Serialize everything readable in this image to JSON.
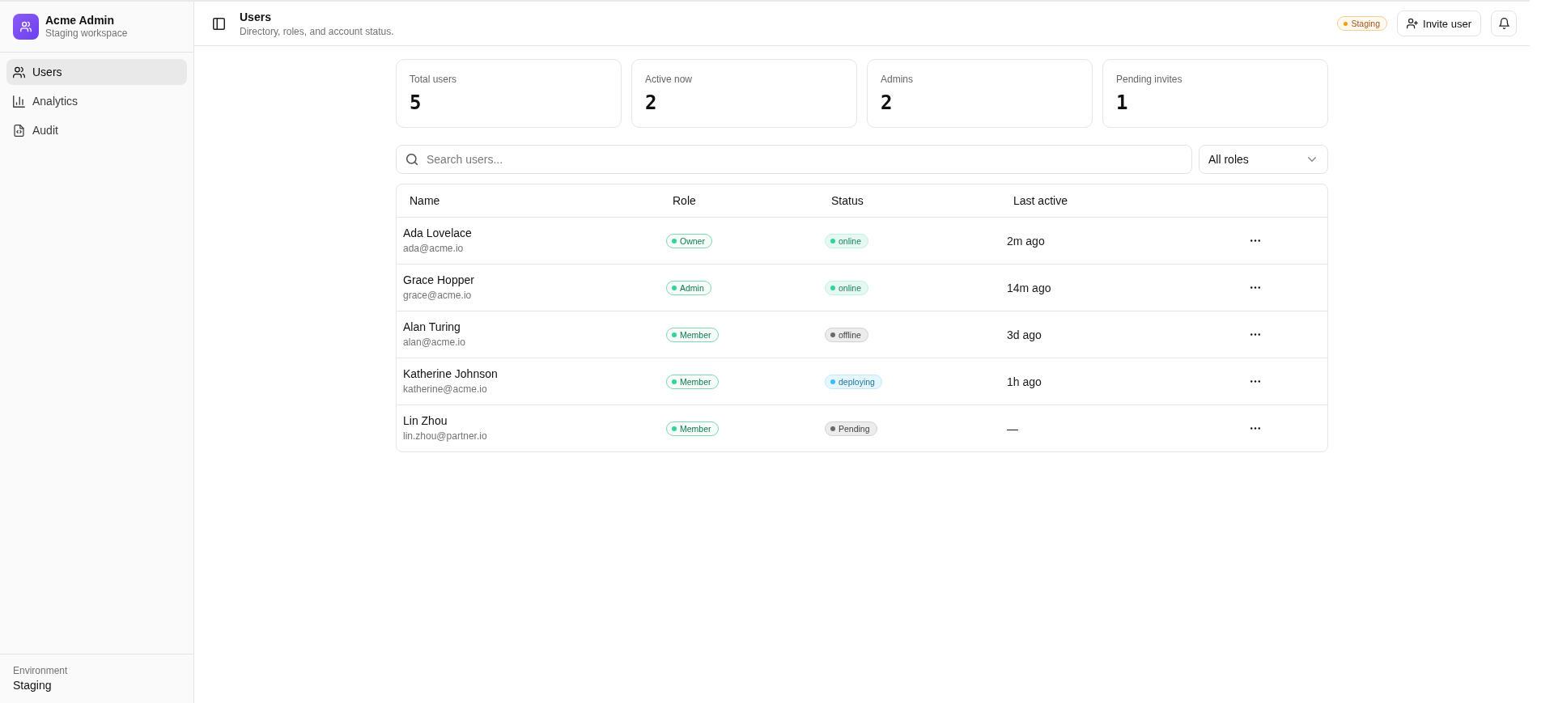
{
  "sidebar": {
    "app_name": "Acme Admin",
    "workspace": "Staging workspace",
    "items": [
      {
        "label": "Users",
        "kind": "users",
        "selected": true
      },
      {
        "label": "Analytics",
        "kind": "analytics",
        "selected": false
      },
      {
        "label": "Audit",
        "kind": "audit",
        "selected": false
      }
    ],
    "footer": {
      "label": "Environment",
      "value": "Staging"
    }
  },
  "header": {
    "title": "Users",
    "subtitle": "Directory, roles, and account status.",
    "environment_badge": "Staging",
    "invite_button": "Invite user"
  },
  "stats": [
    {
      "label": "Total users",
      "value": "5"
    },
    {
      "label": "Active now",
      "value": "2"
    },
    {
      "label": "Admins",
      "value": "2"
    },
    {
      "label": "Pending invites",
      "value": "1"
    }
  ],
  "search": {
    "placeholder": "Search users..."
  },
  "role_filter": {
    "value": "All roles"
  },
  "table": {
    "columns": [
      "Name",
      "Role",
      "Status",
      "Last active"
    ],
    "rows": [
      {
        "name": "Ada Lovelace",
        "email": "ada@acme.io",
        "role": "Owner",
        "status": {
          "label": "online",
          "color": "#34d399"
        },
        "last_active": "2m ago"
      },
      {
        "name": "Grace Hopper",
        "email": "grace@acme.io",
        "role": "Admin",
        "status": {
          "label": "online",
          "color": "#34d399"
        },
        "last_active": "14m ago"
      },
      {
        "name": "Alan Turing",
        "email": "alan@acme.io",
        "role": "Member",
        "status": {
          "label": "offline",
          "color": "#6b6b6b"
        },
        "last_active": "3d ago"
      },
      {
        "name": "Katherine Johnson",
        "email": "katherine@acme.io",
        "role": "Member",
        "status": {
          "label": "deploying",
          "color": "#38bdf8"
        },
        "last_active": "1h ago"
      },
      {
        "name": "Lin Zhou",
        "email": "lin.zhou@partner.io",
        "role": "Member",
        "status": {
          "label": "Pending",
          "color": "#6b6b6b"
        },
        "last_active": "—"
      }
    ]
  }
}
